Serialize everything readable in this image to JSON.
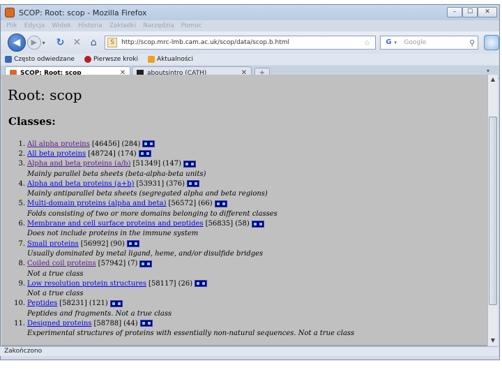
{
  "window": {
    "title": "SCOP: Root: scop - Mozilla Firefox",
    "minimize": "–",
    "maximize": "☐",
    "close": "✕"
  },
  "menu": [
    "Plik",
    "Edycja",
    "Widok",
    "Historia",
    "Zakładki",
    "Narzędzia",
    "Pomoc"
  ],
  "nav": {
    "url": "http://scop.mrc-lmb.cam.ac.uk/scop/data/scop.b.html",
    "search_placeholder": "Google",
    "search_engine": "G"
  },
  "bookmarks": [
    "Często odwiedzane",
    "Pierwsze kroki",
    "Aktualności"
  ],
  "tabs": [
    {
      "label": "SCOP: Root: scop",
      "close": "✕"
    },
    {
      "label": "aboutsintro (CATH)",
      "close": "✕"
    }
  ],
  "new_tab": "+",
  "all_tabs": "▾",
  "page": {
    "title": "Root: scop",
    "section": "Classes:",
    "classes": [
      {
        "num": "1.",
        "name": "All alpha proteins",
        "sunid": "[46456]",
        "count": "(284)",
        "visited": true,
        "desc": ""
      },
      {
        "num": "2.",
        "name": "All beta proteins",
        "sunid": "[48724]",
        "count": "(174)",
        "visited": false,
        "desc": ""
      },
      {
        "num": "3.",
        "name": "Alpha and beta proteins (a/b)",
        "sunid": "[51349]",
        "count": "(147)",
        "visited": true,
        "desc": "Mainly parallel beta sheets (beta-alpha-beta units)"
      },
      {
        "num": "4.",
        "name": "Alpha and beta proteins (a+b)",
        "sunid": "[53931]",
        "count": "(376)",
        "visited": false,
        "desc": "Mainly antiparallel beta sheets (segregated alpha and beta regions)"
      },
      {
        "num": "5.",
        "name": "Multi-domain proteins (alpha and beta)",
        "sunid": "[56572]",
        "count": "(66)",
        "visited": false,
        "desc": "Folds consisting of two or more domains belonging to different classes"
      },
      {
        "num": "6.",
        "name": "Membrane and cell surface proteins and peptides",
        "sunid": "[56835]",
        "count": "(58)",
        "visited": false,
        "desc": "Does not include proteins in the immune system"
      },
      {
        "num": "7.",
        "name": "Small proteins",
        "sunid": "[56992]",
        "count": "(90)",
        "visited": false,
        "desc": "Usually dominated by metal ligand, heme, and/or disulfide bridges"
      },
      {
        "num": "8.",
        "name": "Coiled coil proteins",
        "sunid": "[57942]",
        "count": "(7)",
        "visited": true,
        "desc": "Not a true class"
      },
      {
        "num": "9.",
        "name": "Low resolution protein structures",
        "sunid": "[58117]",
        "count": "(26)",
        "visited": false,
        "desc": "Not a true class"
      },
      {
        "num": "10.",
        "name": "Peptides",
        "sunid": "[58231]",
        "count": "(121)",
        "visited": false,
        "desc": "Peptides and fragments. Not a true class"
      },
      {
        "num": "11.",
        "name": "Designed proteins",
        "sunid": "[58788]",
        "count": "(44)",
        "visited": false,
        "desc": "Experimental structures of proteins with essentially non-natural sequences. Not a true class"
      }
    ]
  },
  "status": "Zakończono",
  "colors": {
    "link": "#0000ee",
    "visited": "#551a8b",
    "page_bg": "#c0c0c0"
  }
}
